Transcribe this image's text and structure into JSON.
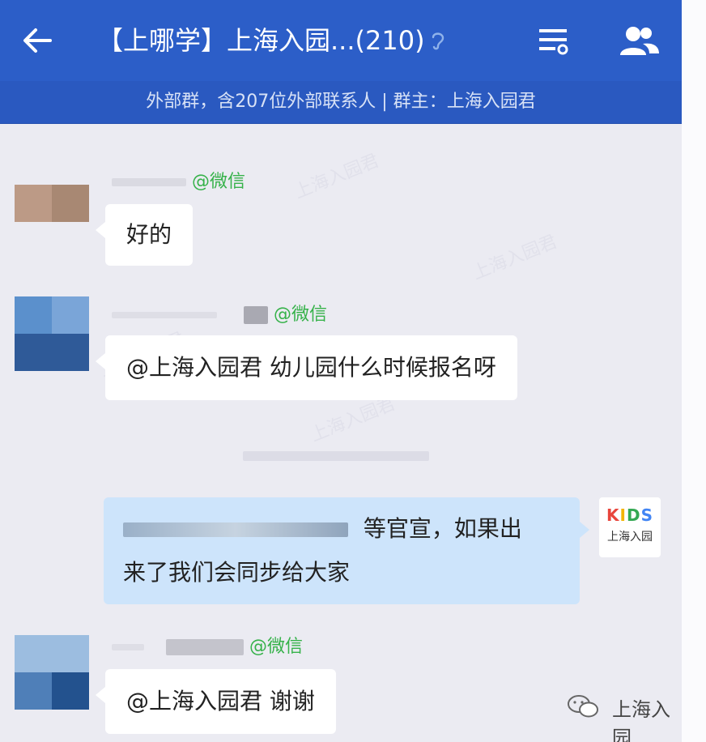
{
  "header": {
    "title": "【上哪学】上海入园...(210)",
    "subtitle": "外部群，含207位外部联系人 | 群主：上海入园君",
    "icons": [
      "back-arrow-icon",
      "mute-ear-icon",
      "group-menu-icon",
      "members-icon"
    ]
  },
  "messages": [
    {
      "source_tag": "@微信",
      "text": "好的"
    },
    {
      "source_tag": "@微信",
      "text": "@上海入园君 幼儿园什么时候报名呀"
    },
    {
      "mine": true,
      "line1": "等官宣，如果出",
      "line2": "来了我们会同步给大家"
    },
    {
      "source_tag": "@微信",
      "text": "@上海入园君 谢谢"
    }
  ],
  "logo": {
    "word": "KIDS",
    "sub": "上海入园"
  },
  "watermark": {
    "text": "上海入园"
  },
  "colors": {
    "header": "#2c5ec8",
    "wechat_tag": "#36b24a",
    "my_bubble": "#cde4fb"
  }
}
